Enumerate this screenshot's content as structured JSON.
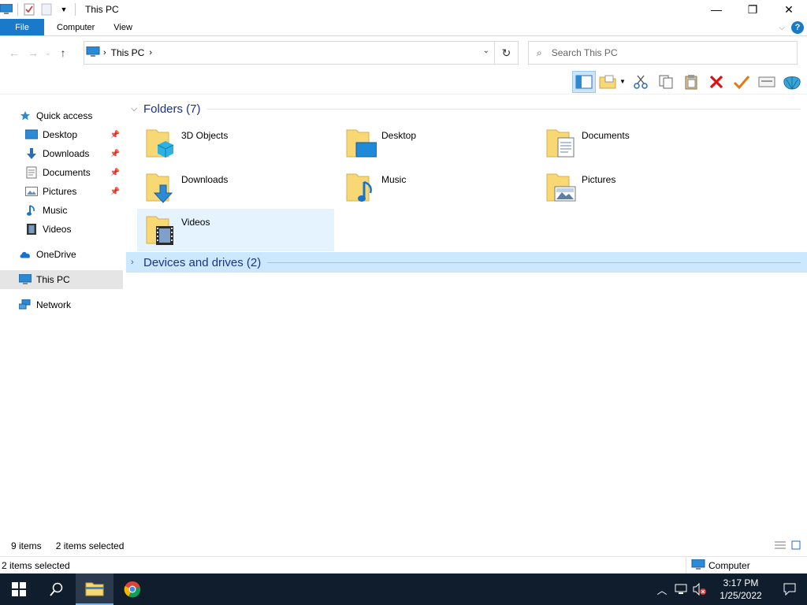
{
  "window": {
    "title": "This PC",
    "controls": {
      "minimize": "—",
      "restore": "❐",
      "close": "✕"
    }
  },
  "ribbon": {
    "tabs": [
      {
        "label": "File"
      },
      {
        "label": "Computer"
      },
      {
        "label": "View"
      }
    ],
    "help": "?"
  },
  "address": {
    "crumbs": [
      "This PC"
    ],
    "search_placeholder": "Search This PC"
  },
  "nav": {
    "quick_access": "Quick access",
    "quick_items": [
      {
        "label": "Desktop",
        "icon": "desktop-icon",
        "pinned": true
      },
      {
        "label": "Downloads",
        "icon": "downloads-icon",
        "pinned": true
      },
      {
        "label": "Documents",
        "icon": "documents-icon",
        "pinned": true
      },
      {
        "label": "Pictures",
        "icon": "pictures-icon",
        "pinned": true
      },
      {
        "label": "Music",
        "icon": "music-icon",
        "pinned": false
      },
      {
        "label": "Videos",
        "icon": "videos-icon",
        "pinned": false
      }
    ],
    "onedrive": "OneDrive",
    "this_pc": "This PC",
    "network": "Network"
  },
  "content": {
    "folders_header": "Folders (7)",
    "folders": [
      {
        "label": "3D Objects",
        "overlay": "3d-objects-icon"
      },
      {
        "label": "Desktop",
        "overlay": "desktop-icon"
      },
      {
        "label": "Documents",
        "overlay": "documents-icon"
      },
      {
        "label": "Downloads",
        "overlay": "downloads-icon"
      },
      {
        "label": "Music",
        "overlay": "music-icon"
      },
      {
        "label": "Pictures",
        "overlay": "pictures-icon"
      },
      {
        "label": "Videos",
        "overlay": "videos-icon",
        "selected": true
      }
    ],
    "devices_header": "Devices and drives (2)"
  },
  "status": {
    "item_count": "9 items",
    "selected_count": "2 items selected",
    "bottom_left": "2 items selected",
    "bottom_right": "Computer"
  },
  "taskbar": {
    "time": "3:17 PM",
    "date": "1/25/2022"
  },
  "colors": {
    "accent": "#1979ca",
    "header_blue": "#1e3287",
    "taskbar": "#101d2c",
    "folder_yellow": "#f8d775"
  }
}
